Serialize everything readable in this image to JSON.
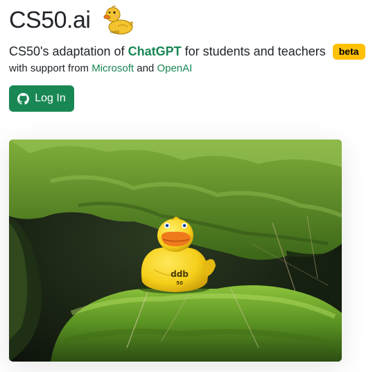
{
  "header": {
    "title": "CS50.ai",
    "logo_icon": "rubber-duck-logo-icon",
    "logo_text": "cs50"
  },
  "tagline": {
    "prefix": "CS50's adaptation of",
    "brand": "ChatGPT",
    "suffix": "for students and teachers",
    "badge": "beta"
  },
  "support": {
    "prefix": "with support from",
    "partner1": "Microsoft",
    "conjunction": "and",
    "partner2": "OpenAI"
  },
  "login_button": {
    "icon": "github-icon",
    "label": "Log In"
  },
  "hero": {
    "description_icon": "rubber-duck-on-moss-photo",
    "duck_text_line1": "ddb",
    "duck_text_line2": "50"
  },
  "colors": {
    "brand_green": "#198754",
    "badge_yellow": "#ffc107",
    "text": "#212529",
    "duck_yellow": "#f7d21c",
    "beak_orange": "#ef7a1c",
    "moss_green": "#4f8a1f"
  }
}
